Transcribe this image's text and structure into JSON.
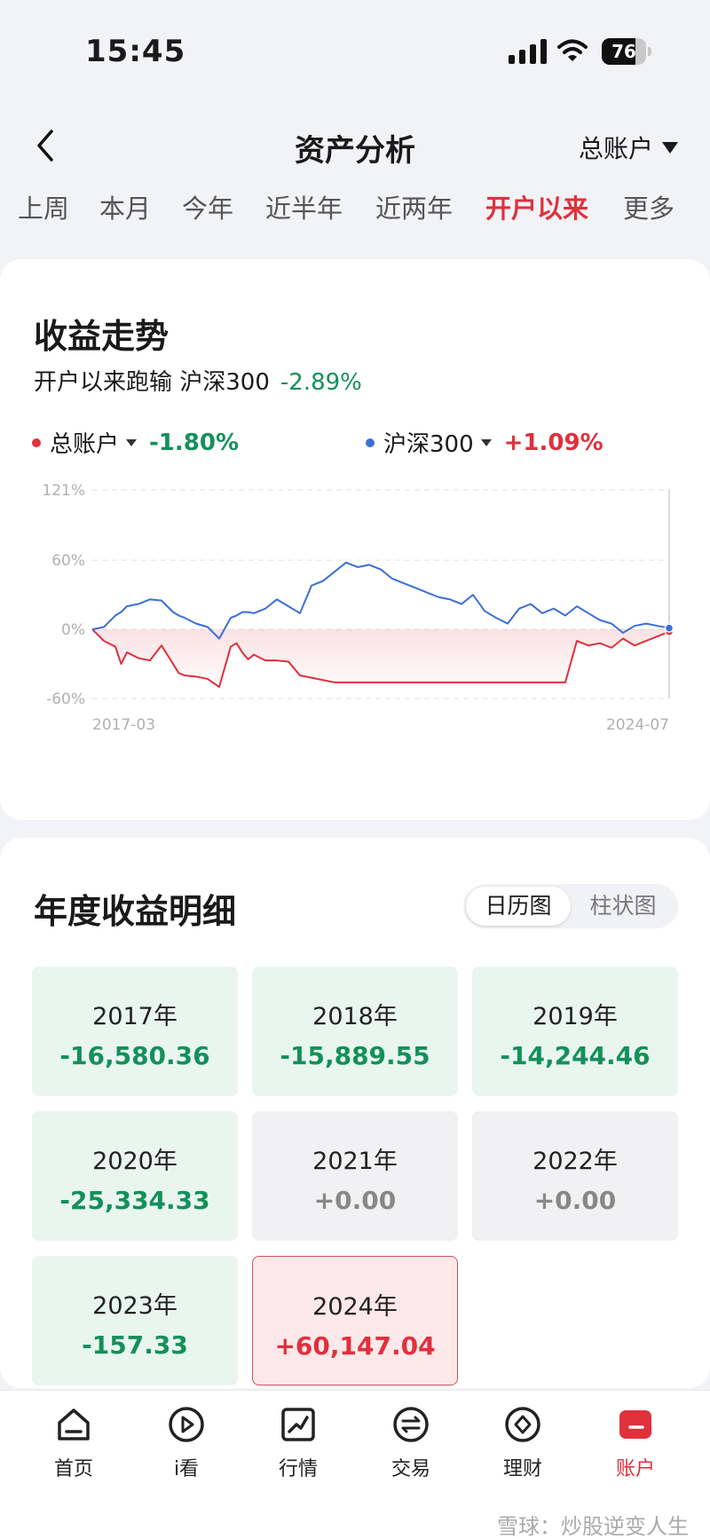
{
  "status_bar": {
    "time": "15:45",
    "battery_level": 76
  },
  "nav": {
    "title": "资产分析",
    "account_label": "总账户"
  },
  "period_tabs": [
    {
      "label": "上周",
      "active": false
    },
    {
      "label": "本月",
      "active": false
    },
    {
      "label": "今年",
      "active": false
    },
    {
      "label": "近半年",
      "active": false
    },
    {
      "label": "近两年",
      "active": false
    },
    {
      "label": "开户以来",
      "active": true
    },
    {
      "label": "更多",
      "active": false
    }
  ],
  "trend": {
    "title": "收益走势",
    "compare_text": "开户以来跑输 沪深300",
    "compare_value": "-2.89%",
    "legend": [
      {
        "name": "总账户",
        "value": "-1.80%",
        "color": "#e0303c"
      },
      {
        "name": "沪深300",
        "value": "+1.09%",
        "color": "#3b6fd8"
      }
    ]
  },
  "chart_data": {
    "type": "line",
    "x_start_label": "2017-03",
    "x_end_label": "2024-07",
    "x": [
      0,
      0.02,
      0.04,
      0.05,
      0.06,
      0.08,
      0.1,
      0.12,
      0.14,
      0.15,
      0.16,
      0.18,
      0.2,
      0.22,
      0.24,
      0.25,
      0.26,
      0.27,
      0.28,
      0.3,
      0.32,
      0.34,
      0.36,
      0.38,
      0.4,
      0.42,
      0.44,
      0.46,
      0.48,
      0.5,
      0.52,
      0.54,
      0.56,
      0.58,
      0.6,
      0.62,
      0.64,
      0.66,
      0.68,
      0.7,
      0.72,
      0.74,
      0.76,
      0.78,
      0.8,
      0.82,
      0.84,
      0.86,
      0.88,
      0.9,
      0.92,
      0.94,
      0.96,
      0.98,
      1
    ],
    "y_ticks": [
      121,
      60,
      0,
      -60
    ],
    "y_tick_labels": [
      "121%",
      "60%",
      "0%",
      "-60%"
    ],
    "ylim": [
      -60,
      121
    ],
    "series": [
      {
        "name": "总账户",
        "color": "#e0303c",
        "values": [
          0,
          -10,
          -15,
          -30,
          -20,
          -25,
          -27,
          -14,
          -30,
          -38,
          -40,
          -41,
          -43,
          -50,
          -15,
          -12,
          -20,
          -26,
          -22,
          -27,
          -27,
          -28,
          -40,
          -42,
          -44,
          -46,
          -46,
          -46,
          -46,
          -46,
          -46,
          -46,
          -46,
          -46,
          -46,
          -46,
          -46,
          -46,
          -46,
          -46,
          -46,
          -46,
          -46,
          -46,
          -46,
          -46,
          -10,
          -14,
          -12,
          -16,
          -8,
          -14,
          -10,
          -6,
          -2
        ]
      },
      {
        "name": "沪深300",
        "color": "#3b6fd8",
        "values": [
          0,
          2,
          12,
          15,
          20,
          22,
          26,
          25,
          15,
          12,
          10,
          5,
          2,
          -8,
          10,
          12,
          15,
          15,
          14,
          18,
          26,
          20,
          14,
          38,
          42,
          50,
          58,
          54,
          56,
          52,
          44,
          40,
          36,
          32,
          28,
          26,
          22,
          30,
          16,
          10,
          5,
          18,
          22,
          14,
          18,
          12,
          20,
          14,
          8,
          5,
          -3,
          3,
          5,
          3,
          1.09
        ]
      }
    ]
  },
  "yearly": {
    "title": "年度收益明细",
    "view_options": [
      {
        "label": "日历图",
        "active": true
      },
      {
        "label": "柱状图",
        "active": false
      }
    ],
    "years": [
      {
        "year": "2017年",
        "value": "-16,580.36",
        "status": "loss"
      },
      {
        "year": "2018年",
        "value": "-15,889.55",
        "status": "loss"
      },
      {
        "year": "2019年",
        "value": "-14,244.46",
        "status": "loss"
      },
      {
        "year": "2020年",
        "value": "-25,334.33",
        "status": "loss"
      },
      {
        "year": "2021年",
        "value": "+0.00",
        "status": "zero"
      },
      {
        "year": "2022年",
        "value": "+0.00",
        "status": "zero"
      },
      {
        "year": "2023年",
        "value": "-157.33",
        "status": "loss"
      },
      {
        "year": "2024年",
        "value": "+60,147.04",
        "status": "gain"
      }
    ]
  },
  "tab_bar": [
    {
      "label": "首页",
      "icon": "home-icon",
      "active": false
    },
    {
      "label": "i看",
      "icon": "play-icon",
      "active": false
    },
    {
      "label": "行情",
      "icon": "market-icon",
      "active": false
    },
    {
      "label": "交易",
      "icon": "trade-icon",
      "active": false
    },
    {
      "label": "理财",
      "icon": "wealth-icon",
      "active": false
    },
    {
      "label": "账户",
      "icon": "account-icon",
      "active": true
    }
  ],
  "watermark": "雪球：炒股逆变人生"
}
